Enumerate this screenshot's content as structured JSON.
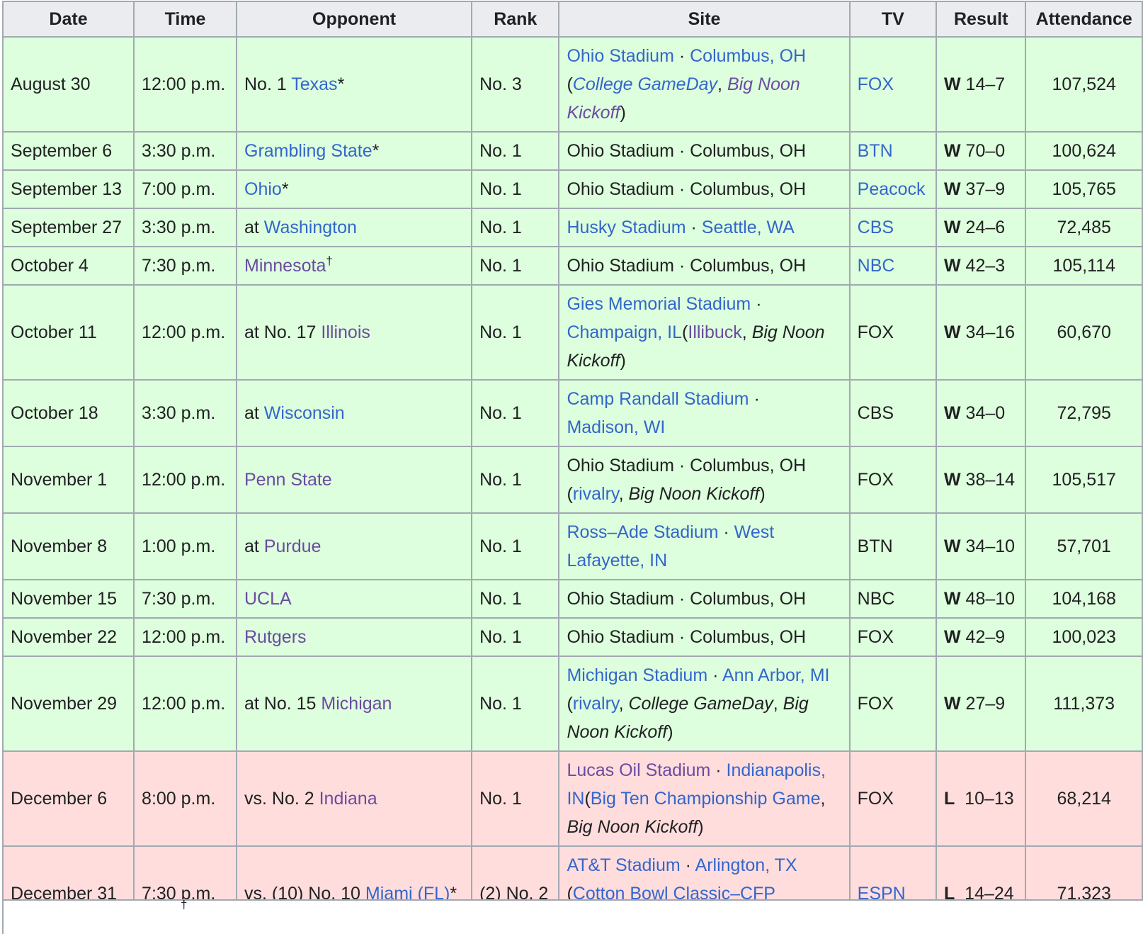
{
  "headers": {
    "date": "Date",
    "time": "Time",
    "opponent": "Opponent",
    "rank": "Rank",
    "site": "Site",
    "tv": "TV",
    "result": "Result",
    "attendance": "Attendance"
  },
  "symbols": {
    "sep": " · ",
    "open": "(",
    "close": ")",
    "comma": ", ",
    "star": "*",
    "dagger": "†"
  },
  "rows": [
    {
      "date": "August 30",
      "time": "12:00 p.m.",
      "opp_pre": "No. 1 ",
      "opp": "Texas",
      "rank": "No. 3",
      "stadium": "Ohio Stadium",
      "city": "Columbus, OH",
      "notes": [
        "College GameDay",
        "Big Noon Kickoff"
      ],
      "tv": "FOX",
      "wl": "W",
      "score": "14–7",
      "att": "107,524"
    },
    {
      "date": "September 6",
      "time": "3:30 p.m.",
      "opp": "Grambling State",
      "rank": "No. 1",
      "stadium": "Ohio Stadium",
      "city": "Columbus, OH",
      "tv": "BTN",
      "wl": "W",
      "score": "70–0",
      "att": "100,624"
    },
    {
      "date": "September 13",
      "time": "7:00 p.m.",
      "opp": "Ohio",
      "rank": "No. 1",
      "stadium": "Ohio Stadium",
      "city": "Columbus, OH",
      "tv": "Peacock",
      "wl": "W",
      "score": "37–9",
      "att": "105,765"
    },
    {
      "date": "September 27",
      "time": "3:30 p.m.",
      "opp_pre": "at ",
      "opp": "Washington",
      "rank": "No. 1",
      "stadium": "Husky Stadium",
      "city": "Seattle, WA",
      "tv": "CBS",
      "wl": "W",
      "score": "24–6",
      "att": "72,485"
    },
    {
      "date": "October 4",
      "time": "7:30 p.m.",
      "opp": "Minnesota",
      "rank": "No. 1",
      "stadium": "Ohio Stadium",
      "city": "Columbus, OH",
      "tv": "NBC",
      "wl": "W",
      "score": "42–3",
      "att": "105,114"
    },
    {
      "date": "October 11",
      "time": "12:00 p.m.",
      "opp_pre": "at No. 17 ",
      "opp": "Illinois",
      "rank": "No. 1",
      "stadium": "Gies Memorial Stadium",
      "city": "Champaign, IL",
      "notes": [
        "Illibuck",
        "Big Noon Kickoff"
      ],
      "tv": "FOX",
      "wl": "W",
      "score": "34–16",
      "att": "60,670"
    },
    {
      "date": "October 18",
      "time": "3:30 p.m.",
      "opp_pre": "at ",
      "opp": "Wisconsin",
      "rank": "No. 1",
      "stadium": "Camp Randall Stadium",
      "city": "Madison, WI",
      "tv": "CBS",
      "wl": "W",
      "score": "34–0",
      "att": "72,795"
    },
    {
      "date": "November 1",
      "time": "12:00 p.m.",
      "opp": "Penn State",
      "rank": "No. 1",
      "stadium": "Ohio Stadium",
      "city": "Columbus, OH",
      "notes": [
        "rivalry",
        "Big Noon Kickoff"
      ],
      "tv": "FOX",
      "wl": "W",
      "score": "38–14",
      "att": "105,517"
    },
    {
      "date": "November 8",
      "time": "1:00 p.m.",
      "opp_pre": "at ",
      "opp": "Purdue",
      "rank": "No. 1",
      "stadium": "Ross–Ade Stadium",
      "city": "West Lafayette, IN",
      "tv": "BTN",
      "wl": "W",
      "score": "34–10",
      "att": "57,701"
    },
    {
      "date": "November 15",
      "time": "7:30 p.m.",
      "opp": "UCLA",
      "rank": "No. 1",
      "stadium": "Ohio Stadium",
      "city": "Columbus, OH",
      "tv": "NBC",
      "wl": "W",
      "score": "48–10",
      "att": "104,168"
    },
    {
      "date": "November 22",
      "time": "12:00 p.m.",
      "opp": "Rutgers",
      "rank": "No. 1",
      "stadium": "Ohio Stadium",
      "city": "Columbus, OH",
      "tv": "FOX",
      "wl": "W",
      "score": "42–9",
      "att": "100,023"
    },
    {
      "date": "November 29",
      "time": "12:00 p.m.",
      "opp_pre": "at No. 15 ",
      "opp": "Michigan",
      "rank": "No. 1",
      "stadium": "Michigan Stadium",
      "city": "Ann Arbor, MI",
      "notes": [
        "rivalry",
        "College GameDay",
        "Big Noon Kickoff"
      ],
      "tv": "FOX",
      "wl": "W",
      "score": "27–9",
      "att": "111,373"
    },
    {
      "date": "December 6",
      "time": "8:00 p.m.",
      "opp_pre": "vs. No. 2 ",
      "opp": "Indiana",
      "rank": "No. 1",
      "stadium": "Lucas Oil Stadium",
      "city": "Indianapolis, IN",
      "notes": [
        "Big Ten Championship Game",
        "Big Noon Kickoff"
      ],
      "tv": "FOX",
      "wl": "L",
      "score": "10–13",
      "att": "68,214"
    },
    {
      "date": "December 31",
      "time": "7:30 p.m.",
      "opp_pre": "vs. (10) No. 10 ",
      "opp": "Miami (FL)",
      "rank": "(2) No. 2",
      "stadium": "AT&T Stadium",
      "city": "Arlington, TX",
      "notes": [
        "Cotton Bowl Classic–CFP Quarterfinal"
      ],
      "tv": "ESPN",
      "wl": "L",
      "score": "14–24",
      "att": "71,323"
    }
  ]
}
